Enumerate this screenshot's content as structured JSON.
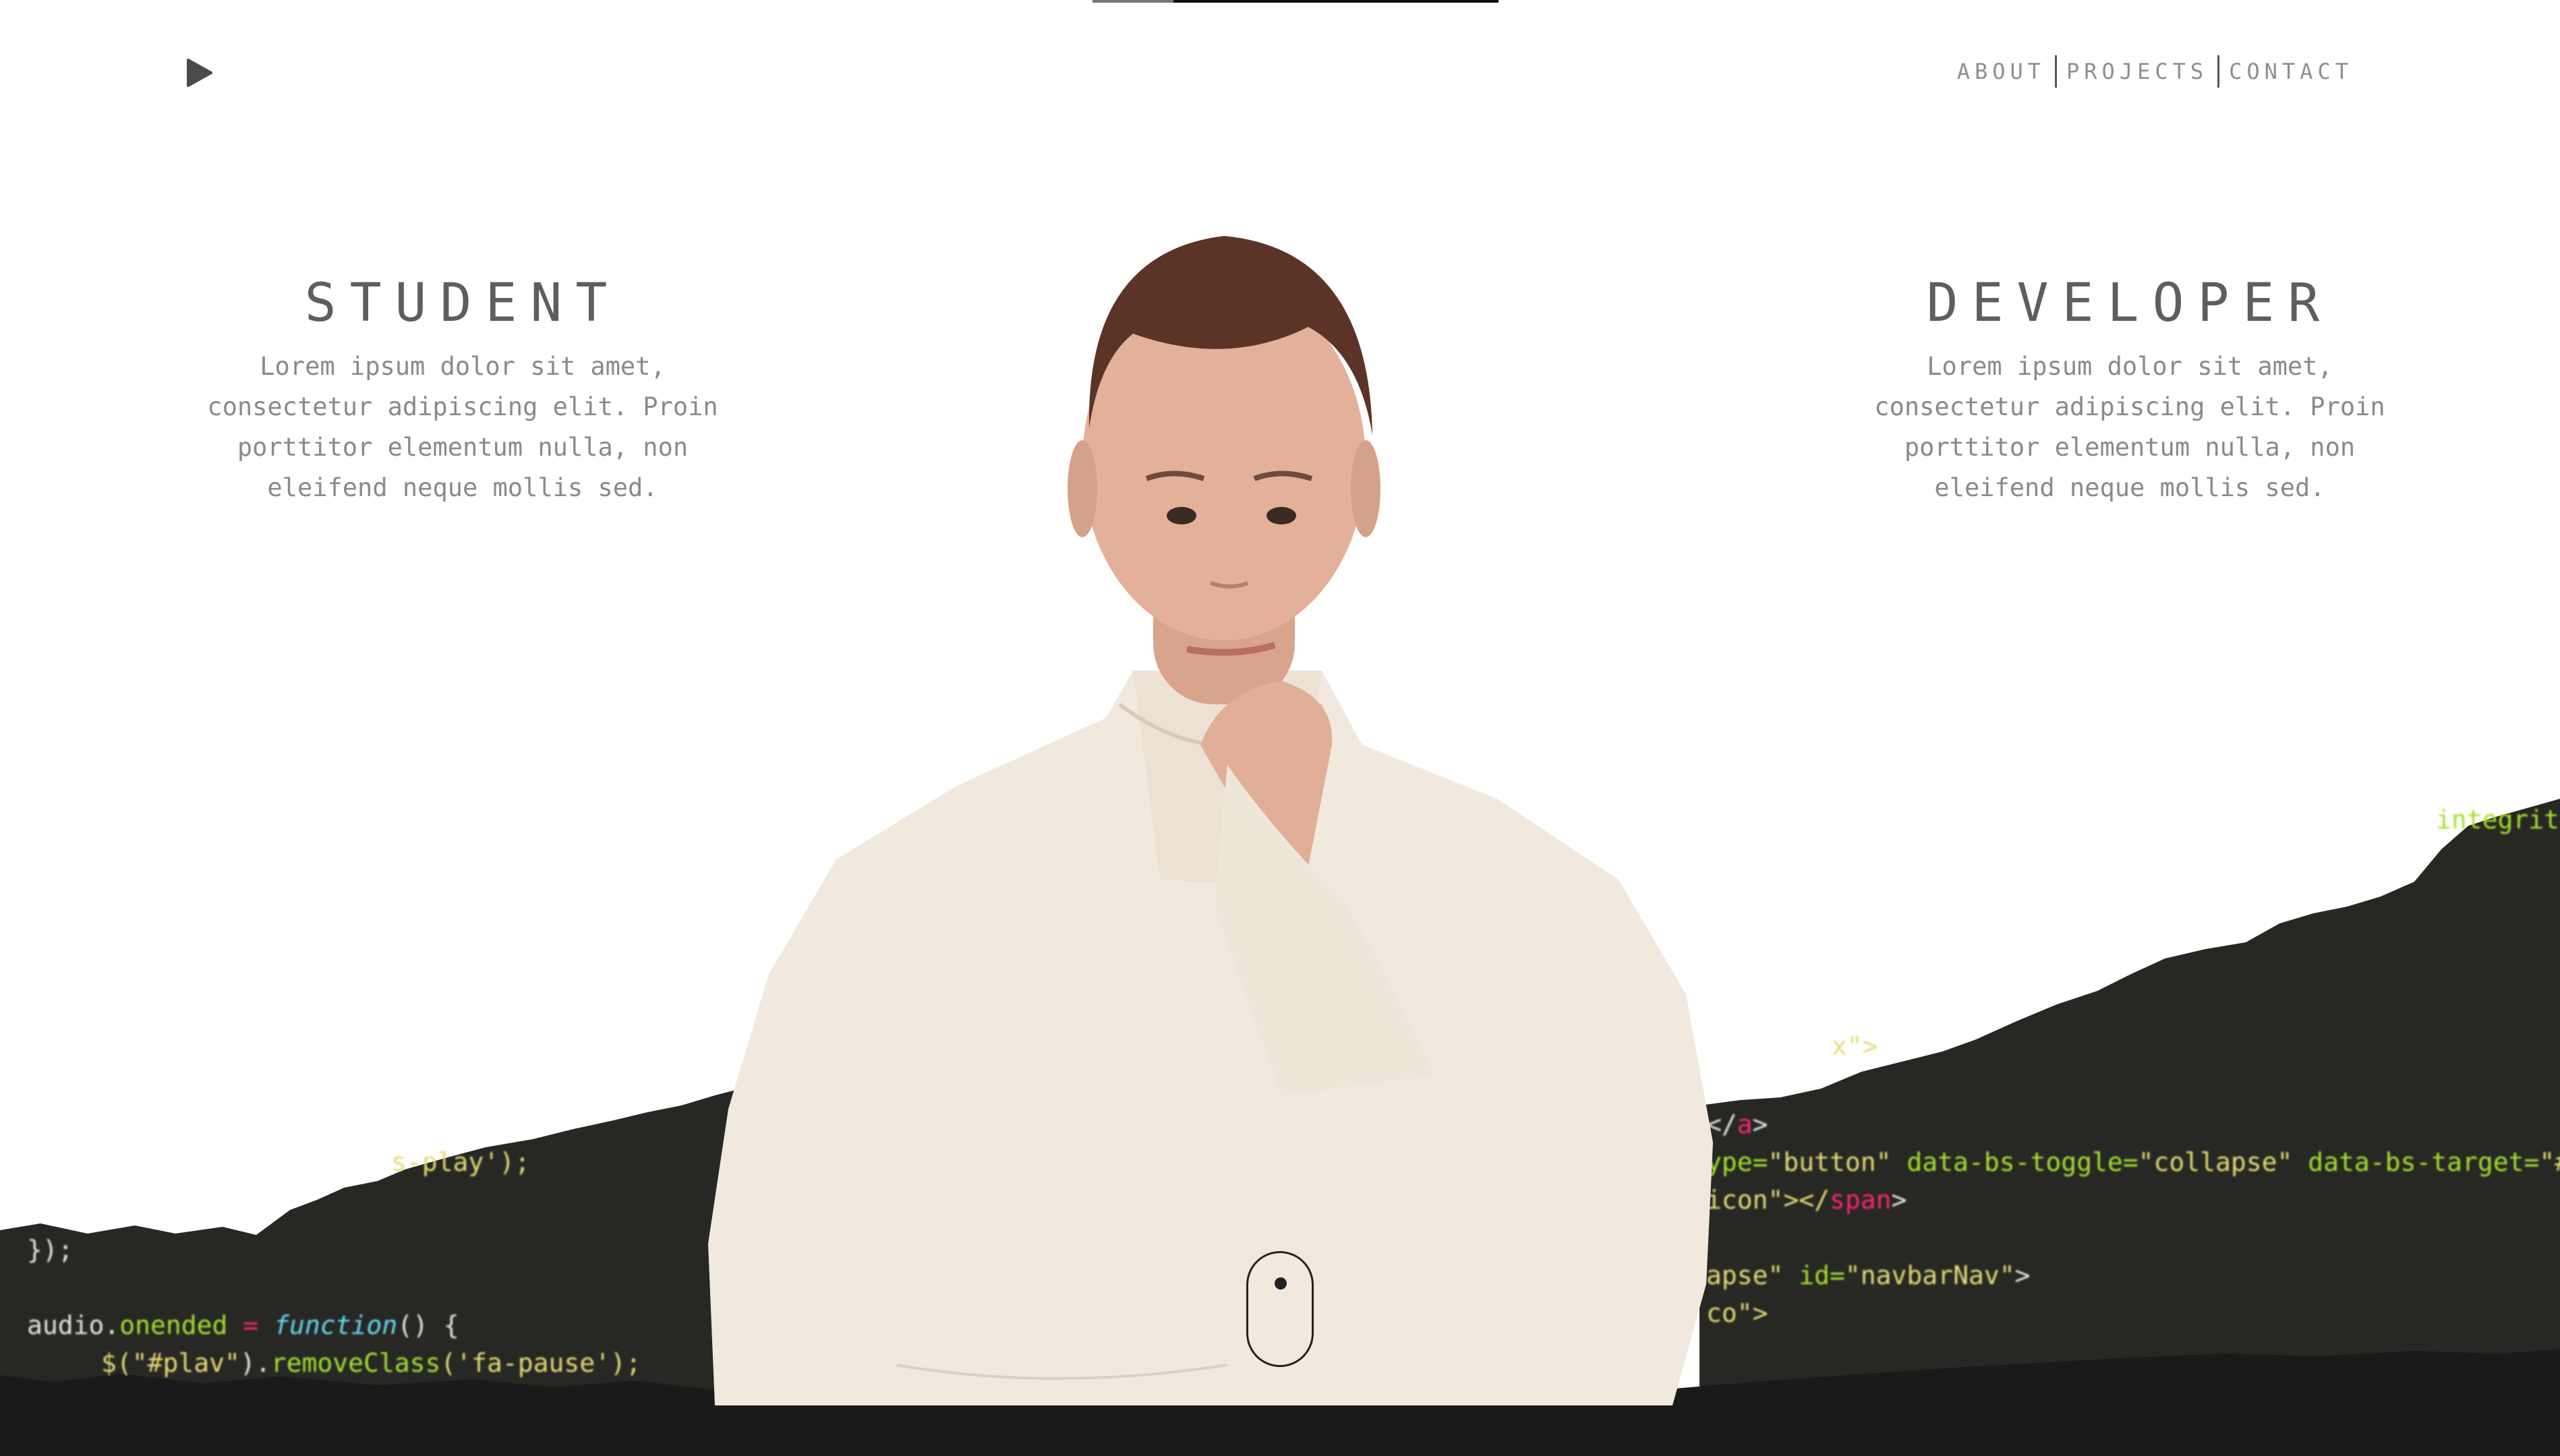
{
  "nav": {
    "play_icon": "play-icon",
    "items": [
      {
        "label": "ABOUT"
      },
      {
        "label": "PROJECTS"
      },
      {
        "label": "CONTACT"
      }
    ]
  },
  "hero": {
    "left": {
      "title": "STUDENT",
      "body_lines": [
        "Lorem ipsum dolor sit amet,",
        "consectetur adipiscing elit. Proin",
        "porttitor elementum nulla, non",
        "eleifend neque mollis sed."
      ]
    },
    "right": {
      "title": "DEVELOPER",
      "body_lines": [
        "Lorem ipsum dolor sit amet,",
        "consectetur adipiscing elit. Proin",
        "porttitor elementum nulla, non",
        "eleifend neque mollis sed."
      ]
    }
  },
  "code_left": {
    "line1": "s-play');",
    "line2": "});",
    "line3a": "audio.",
    "line3b": "onended",
    "line3c": " = ",
    "line3d": "function",
    "line3e": "() {",
    "line4a": "$(",
    "line4b": "\"#plav\"",
    "line4c": ").",
    "line4d": "removeClass",
    "line4e": "('fa-pause');"
  },
  "code_right": {
    "line0": "integrity",
    "line1": "x\">",
    "line2a": "</",
    "line2b": "a",
    "line2c": ">",
    "line3a": "ype=",
    "line3b": "\"button\"",
    "line3c": " data-bs-toggle=",
    "line3d": "\"collapse\"",
    "line3e": " data-bs-target=",
    "line3f": "\"#",
    "line4a": "icon\"></",
    "line4b": "span",
    "line4c": ">",
    "line5a": "apse\" ",
    "line5b": "id=",
    "line5c": "\"navbarNav\"",
    "line5d": ">",
    "line6": "co\">"
  },
  "scroll_indicator": "mouse-scroll-icon"
}
